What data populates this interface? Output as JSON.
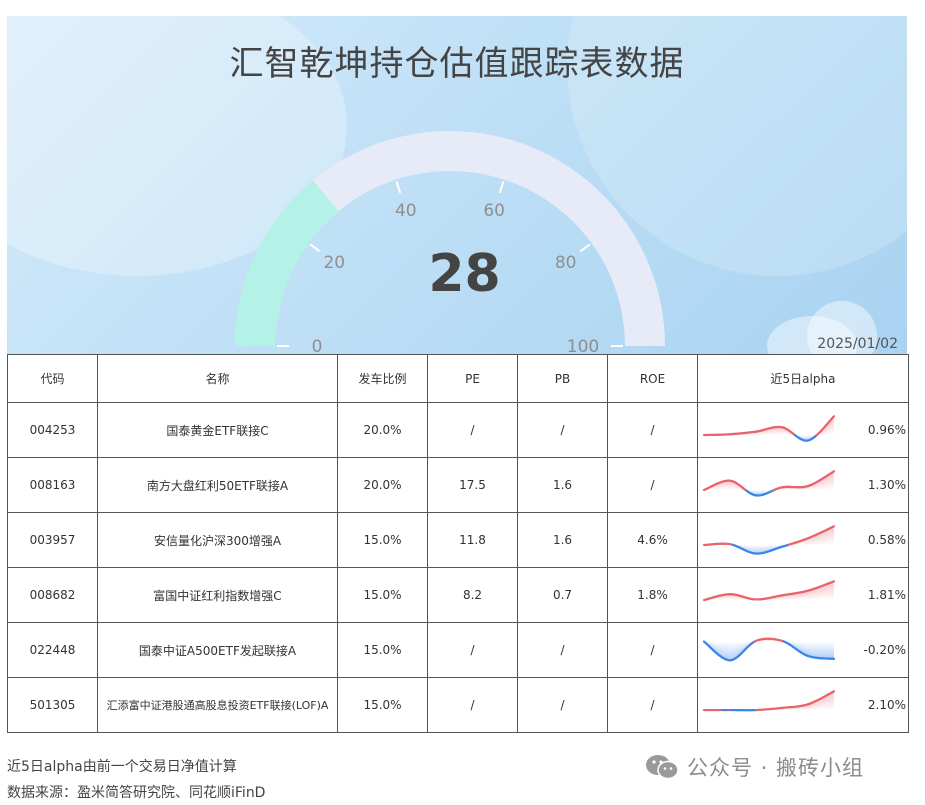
{
  "title": "汇智乾坤持仓估值跟踪表数据",
  "gauge": {
    "value": 28,
    "value_text": "28",
    "min": 0,
    "max": 100,
    "tick_labels": [
      "0",
      "20",
      "40",
      "60",
      "80",
      "100"
    ],
    "progress_color": "#b4f1e6",
    "track_color": "#e6ebf7"
  },
  "date": "2025/01/02",
  "table": {
    "headers": [
      "代码",
      "名称",
      "发车比例",
      "PE",
      "PB",
      "ROE",
      "近5日alpha"
    ],
    "rows": [
      {
        "code": "004253",
        "name": "国泰黄金ETF联接C",
        "ratio": "20.0%",
        "pe": "/",
        "pb": "/",
        "roe": "/",
        "alpha": "0.96%",
        "spark": [
          0.0,
          0.05,
          0.22,
          0.5,
          -0.35,
          1.2
        ]
      },
      {
        "code": "008163",
        "name": "南方大盘红利50ETF联接A",
        "ratio": "20.0%",
        "pe": "17.5",
        "pb": "1.6",
        "roe": "/",
        "alpha": "1.30%",
        "spark": [
          0.0,
          0.7,
          -0.4,
          0.2,
          0.3,
          1.4
        ]
      },
      {
        "code": "003957",
        "name": "安信量化沪深300增强A",
        "ratio": "15.0%",
        "pe": "11.8",
        "pb": "1.6",
        "roe": "4.6%",
        "alpha": "0.58%",
        "spark": [
          0.0,
          0.05,
          -0.5,
          -0.1,
          0.4,
          1.1
        ]
      },
      {
        "code": "008682",
        "name": "富国中证红利指数增强C",
        "ratio": "15.0%",
        "pe": "8.2",
        "pb": "0.7",
        "roe": "1.8%",
        "alpha": "1.81%",
        "spark": [
          0.0,
          0.5,
          0.05,
          0.4,
          0.8,
          1.6
        ]
      },
      {
        "code": "022448",
        "name": "国泰中证A500ETF发起联接A",
        "ratio": "15.0%",
        "pe": "/",
        "pb": "/",
        "roe": "/",
        "alpha": "-0.20%",
        "spark": [
          0.0,
          -1.3,
          0.05,
          0.05,
          -1.0,
          -1.2
        ]
      },
      {
        "code": "501305",
        "name": "汇添富中证港股通高股息投资ETF联接(LOF)A",
        "ratio": "15.0%",
        "pe": "/",
        "pb": "/",
        "roe": "/",
        "alpha": "2.10%",
        "spark": [
          0.0,
          0.0,
          0.0,
          0.15,
          0.4,
          1.3
        ]
      }
    ],
    "positive_color": "#e8636b",
    "negative_color": "#3a86e8"
  },
  "footer": {
    "note": "近5日alpha由前一个交易日净值计算",
    "source": "数据来源：盈米简答研究院、同花顺iFinD"
  },
  "brand": {
    "icon": "wechat-icon",
    "text": "公众号 · 搬砖小组"
  }
}
